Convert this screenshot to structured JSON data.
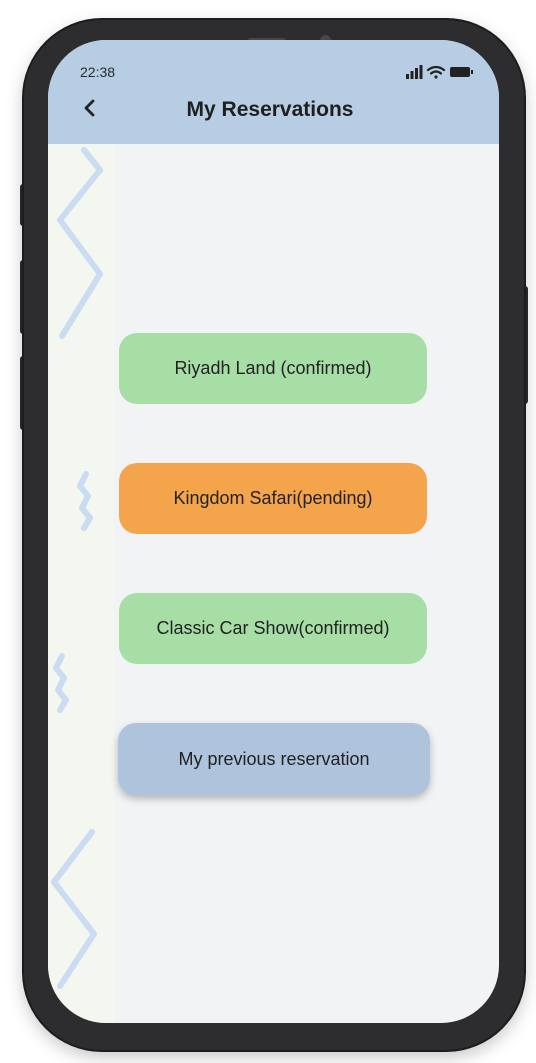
{
  "status_bar": {
    "time": "22:38",
    "icons": [
      "signal-icon",
      "wifi-icon",
      "battery-icon"
    ]
  },
  "header": {
    "title": "My Reservations",
    "back_icon": "chevron-left-icon"
  },
  "reservations": [
    {
      "label": "Riyadh Land (confirmed)",
      "color": "#a6dea6"
    },
    {
      "label": "Kingdom Safari(pending)",
      "color": "#f4a54c"
    },
    {
      "label": "Classic Car Show(confirmed)",
      "color": "#a6dea6"
    }
  ],
  "previous_button": {
    "label": "My previous reservation",
    "color": "#aec3dc"
  },
  "colors": {
    "header": "#b6cde3",
    "screen_background": "#f2f3f5",
    "phone_frame": "#2d2d30",
    "decoration": "#c9dcf2"
  }
}
